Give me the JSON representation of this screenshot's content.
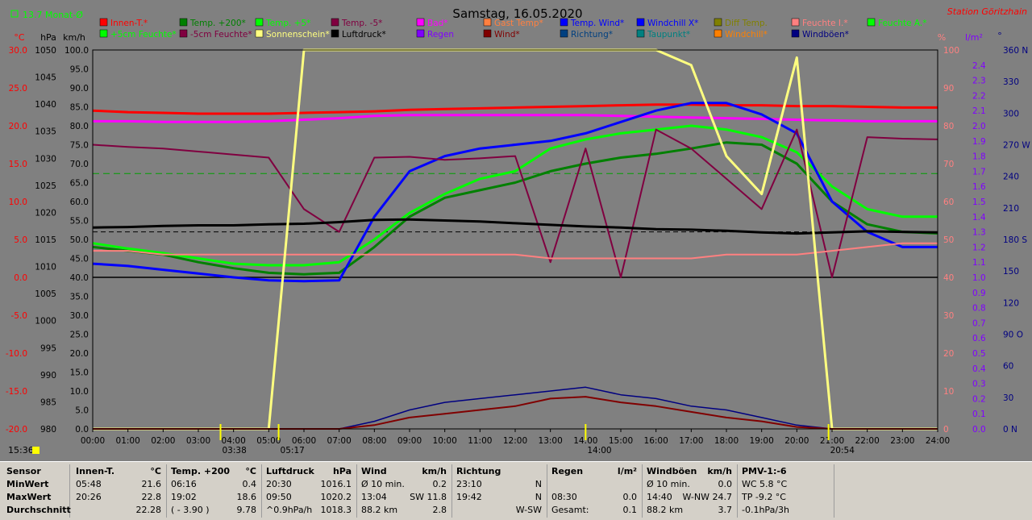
{
  "header": {
    "title": "Samstag, 16.05.2020",
    "station": "Station Göritzhain",
    "month_avg": "13.7 Monat-Ø",
    "time_left": "15:36"
  },
  "legend": [
    {
      "label": "Innen-T.*",
      "color": "#ff0000"
    },
    {
      "label": "Temp. +200*",
      "color": "#008000"
    },
    {
      "label": "Temp. +5*",
      "color": "#00ff00"
    },
    {
      "label": "Temp. -5*",
      "color": "#800040"
    },
    {
      "label": "Bad*",
      "color": "#ff00ff"
    },
    {
      "label": "Gast Temp*",
      "color": "#ff8040"
    },
    {
      "label": "Temp. Wind*",
      "color": "#0000ff"
    },
    {
      "label": "Windchill X*",
      "color": "#0000ff"
    },
    {
      "label": "Diff Temp.",
      "color": "#808000"
    },
    {
      "label": "Feuchte I.*",
      "color": "#ff8080"
    },
    {
      "label": "Feuchte A.*",
      "color": "#00ff00"
    },
    {
      "label": "+5cm Feuchte*",
      "color": "#00ff00"
    },
    {
      "label": "-5cm Feuchte*",
      "color": "#800040"
    },
    {
      "label": "Sonnenschein*",
      "color": "#ffff80"
    },
    {
      "label": "Luftdruck*",
      "color": "#000000"
    },
    {
      "label": "Regen",
      "color": "#8000ff"
    },
    {
      "label": "Wind*",
      "color": "#800000"
    },
    {
      "label": "Richtung*",
      "color": "#004080"
    },
    {
      "label": "Taupunkt*",
      "color": "#008080"
    },
    {
      "label": "Windchill*",
      "color": "#ff8000"
    },
    {
      "label": "Windböen*",
      "color": "#000080"
    }
  ],
  "axes": {
    "temp_unit": "°C",
    "hpa_unit": "hPa",
    "kmh_unit": "km/h",
    "pct_unit": "%",
    "rain_unit": "l/m²",
    "deg_unit": "°",
    "temp_ticks": [
      "30.0",
      "25.0",
      "20.0",
      "15.0",
      "10.0",
      "5.0",
      "0.0",
      "-5.0",
      "-10.0",
      "-15.0",
      "-20.0"
    ],
    "hpa_ticks": [
      "1050",
      "1045",
      "1040",
      "1035",
      "1030",
      "1025",
      "1020",
      "1015",
      "1010",
      "1005",
      "1000",
      "995",
      "990",
      "985",
      "980"
    ],
    "kmh_ticks": [
      "100.0",
      "95.0",
      "90.0",
      "85.0",
      "80.0",
      "75.0",
      "70.0",
      "65.0",
      "60.0",
      "55.0",
      "50.0",
      "45.0",
      "40.0",
      "35.0",
      "30.0",
      "25.0",
      "20.0",
      "15.0",
      "10.0",
      "5.0",
      "0.0"
    ],
    "pct_ticks": [
      "100",
      "90",
      "80",
      "70",
      "60",
      "50",
      "40",
      "30",
      "20",
      "10",
      "0"
    ],
    "rain_ticks": [
      "2.4",
      "2.3",
      "2.2",
      "2.1",
      "2.0",
      "1.9",
      "1.8",
      "1.7",
      "1.6",
      "1.5",
      "1.4",
      "1.3",
      "1.2",
      "1.1",
      "1.0",
      "0.9",
      "0.8",
      "0.7",
      "0.6",
      "0.5",
      "0.4",
      "0.3",
      "0.2",
      "0.1",
      "0.0"
    ],
    "deg_ticks": [
      "360 N",
      "330",
      "300",
      "270 W",
      "240",
      "210",
      "180 S",
      "150",
      "120",
      "90 O",
      "60",
      "30",
      "0 N"
    ],
    "x_ticks": [
      "00:00",
      "01:00",
      "02:00",
      "03:00",
      "04:00",
      "05:00",
      "06:00",
      "07:00",
      "08:00",
      "09:00",
      "10:00",
      "11:00",
      "12:00",
      "13:00",
      "14:00",
      "15:00",
      "16:00",
      "17:00",
      "18:00",
      "19:00",
      "20:00",
      "21:00",
      "22:00",
      "23:00",
      "24:00"
    ],
    "sun_marks": [
      "03:38",
      "05:17",
      "14:00",
      "20:54"
    ]
  },
  "chart_data": {
    "type": "line",
    "x": [
      0,
      1,
      2,
      3,
      4,
      5,
      6,
      7,
      8,
      9,
      10,
      11,
      12,
      13,
      14,
      15,
      16,
      17,
      18,
      19,
      20,
      21,
      22,
      23,
      24
    ],
    "series": [
      {
        "name": "Innen-T.*",
        "axis": "temp",
        "color": "#ff0000",
        "values": [
          22.0,
          21.8,
          21.7,
          21.6,
          21.6,
          21.6,
          21.7,
          21.8,
          21.9,
          22.1,
          22.2,
          22.3,
          22.4,
          22.5,
          22.6,
          22.7,
          22.8,
          22.8,
          22.7,
          22.7,
          22.6,
          22.6,
          22.5,
          22.4,
          22.4
        ]
      },
      {
        "name": "Bad*",
        "axis": "temp",
        "color": "#ff00ff",
        "values": [
          20.6,
          20.6,
          20.5,
          20.5,
          20.5,
          20.6,
          20.8,
          21.0,
          21.3,
          21.4,
          21.4,
          21.4,
          21.4,
          21.4,
          21.4,
          21.3,
          21.2,
          21.1,
          21.0,
          20.9,
          20.8,
          20.7,
          20.6,
          20.6,
          20.6
        ]
      },
      {
        "name": "Temp. +200*",
        "axis": "temp",
        "color": "#008000",
        "values": [
          4.0,
          3.5,
          3.0,
          2.0,
          1.2,
          0.6,
          0.4,
          0.6,
          4.0,
          8.0,
          10.5,
          11.5,
          12.5,
          14.0,
          15.0,
          15.8,
          16.3,
          17.0,
          17.8,
          17.5,
          15.0,
          10.0,
          7.0,
          6.0,
          5.8
        ]
      },
      {
        "name": "Temp. +5*",
        "axis": "temp",
        "color": "#00ff00",
        "values": [
          4.5,
          3.8,
          3.2,
          2.5,
          1.8,
          1.6,
          1.6,
          2.0,
          5.0,
          8.5,
          11.0,
          13.0,
          14.0,
          17.0,
          18.2,
          19.0,
          19.5,
          20.0,
          19.5,
          18.5,
          16.5,
          12.0,
          9.0,
          8.0,
          8.0
        ]
      },
      {
        "name": "Temp. Wind*",
        "axis": "temp",
        "color": "#0000ff",
        "values": [
          1.8,
          1.5,
          1.0,
          0.5,
          0.0,
          -0.4,
          -0.5,
          -0.4,
          8.0,
          14.0,
          16.0,
          17.0,
          17.5,
          18.0,
          19.0,
          20.5,
          22.0,
          23.0,
          23.0,
          21.5,
          19.0,
          10.0,
          6.0,
          4.0,
          4.0
        ]
      },
      {
        "name": "Temp. -5*",
        "axis": "temp",
        "color": "#800040",
        "values": [
          17.5,
          17.2,
          17.0,
          16.6,
          16.2,
          15.8,
          9.0,
          6.0,
          15.8,
          15.9,
          15.5,
          15.7,
          16.0,
          2.0,
          17.0,
          0.0,
          19.5,
          17.0,
          13.0,
          9.0,
          19.5,
          0.0,
          18.5,
          18.3,
          18.2
        ]
      },
      {
        "name": "Luftdruck*",
        "axis": "hpa",
        "color": "#000000",
        "values": [
          1017.2,
          1017.3,
          1017.5,
          1017.6,
          1017.6,
          1017.8,
          1017.9,
          1018.2,
          1018.6,
          1018.7,
          1018.5,
          1018.3,
          1018.0,
          1017.7,
          1017.4,
          1017.2,
          1016.9,
          1016.8,
          1016.6,
          1016.3,
          1016.1,
          1016.3,
          1016.5,
          1016.4,
          1016.3
        ]
      },
      {
        "name": "Feuchte I.*",
        "axis": "pct",
        "color": "#ff8080",
        "values": [
          47,
          47,
          46,
          46,
          46,
          46,
          46,
          46,
          46,
          46,
          46,
          46,
          46,
          45,
          45,
          45,
          45,
          45,
          46,
          46,
          46,
          47,
          48,
          49,
          49
        ]
      },
      {
        "name": "Sonnenschein*",
        "axis": "pct",
        "color": "#ffff80",
        "values": [
          0,
          0,
          0,
          0,
          0,
          0,
          100,
          100,
          100,
          100,
          100,
          100,
          100,
          100,
          100,
          100,
          100,
          96,
          72,
          62,
          98,
          0,
          0,
          0,
          0
        ]
      },
      {
        "name": "Windgeschwindigkeit",
        "axis": "kmh",
        "color": "#000080",
        "values": [
          0,
          0,
          0,
          0,
          0,
          0,
          0,
          0,
          2.0,
          5.0,
          7.0,
          8.0,
          9.0,
          10.0,
          11.0,
          9.0,
          8.0,
          6.0,
          5.0,
          3.0,
          1.0,
          0,
          0,
          0,
          0
        ]
      },
      {
        "name": "Wind*",
        "axis": "kmh",
        "color": "#800000",
        "values": [
          0,
          0,
          0,
          0,
          0,
          0,
          0,
          0,
          1.0,
          3.0,
          4.0,
          5.0,
          6.0,
          8.0,
          8.5,
          7.0,
          6.0,
          4.5,
          3.0,
          2.0,
          0.5,
          0,
          0,
          0,
          0
        ]
      }
    ],
    "xlabel": "",
    "ylabel": "°C",
    "ylim_temp": [
      -20,
      30
    ],
    "ylim_hpa": [
      980,
      1050
    ],
    "ylim_kmh": [
      0,
      100
    ],
    "ylim_pct": [
      0,
      100
    ],
    "ylim_rain": [
      0,
      2.5
    ],
    "ylim_deg": [
      0,
      360
    ],
    "grid": false
  },
  "summary": {
    "row_labels": {
      "title": "Sensor",
      "min": "MinWert",
      "max": "MaxWert",
      "avg": "Durchschnitt"
    },
    "columns": [
      {
        "name": "Innen-T.",
        "unit": "°C",
        "min": {
          "t": "05:48",
          "v": "21.6"
        },
        "max": {
          "t": "20:26",
          "v": "22.8"
        },
        "avg": {
          "t": "",
          "v": "22.28"
        }
      },
      {
        "name": "Temp. +200",
        "unit": "°C",
        "min": {
          "t": "06:16",
          "v": "0.4"
        },
        "max": {
          "t": "19:02",
          "v": "18.6"
        },
        "avg": {
          "t": "( - 3.90 )",
          "v": "9.78"
        }
      },
      {
        "name": "Luftdruck",
        "unit": "hPa",
        "min": {
          "t": "20:30",
          "v": "1016.1"
        },
        "max": {
          "t": "09:50",
          "v": "1020.2"
        },
        "avg": {
          "t": "^0.9hPa/h",
          "v": "1018.3"
        }
      },
      {
        "name": "Wind",
        "unit": "km/h",
        "min": {
          "t": "Ø 10 min.",
          "v": "0.2"
        },
        "max": {
          "t": "13:04",
          "m": "SW 11.8",
          "v": ""
        },
        "avg": {
          "t": "88.2 km",
          "v": "2.8"
        }
      },
      {
        "name": "Richtung",
        "unit": "",
        "min": {
          "t": "23:10",
          "v": "N"
        },
        "max": {
          "t": "19:42",
          "v": "N"
        },
        "avg": {
          "t": "",
          "v": "W-SW"
        }
      },
      {
        "name": "Regen",
        "unit": "l/m²",
        "min": {
          "t": "",
          "v": ""
        },
        "max": {
          "t": "08:30",
          "v": "0.0"
        },
        "avg": {
          "t": "Gesamt:",
          "v": "0.1"
        }
      },
      {
        "name": "Windböen",
        "unit": "km/h",
        "min": {
          "t": "Ø 10 min.",
          "v": "0.0"
        },
        "max": {
          "t": "14:40",
          "m": "W-NW 24.7",
          "v": ""
        },
        "avg": {
          "t": "88.2 km",
          "v": "3.7"
        }
      },
      {
        "name": "PMV-1:-6",
        "unit": "",
        "min": {
          "t": "WC 5.8 °C",
          "v": ""
        },
        "max": {
          "t": "TP -9.2 °C",
          "v": ""
        },
        "avg": {
          "t": "-0.1hPa/3h",
          "v": ""
        }
      }
    ]
  }
}
